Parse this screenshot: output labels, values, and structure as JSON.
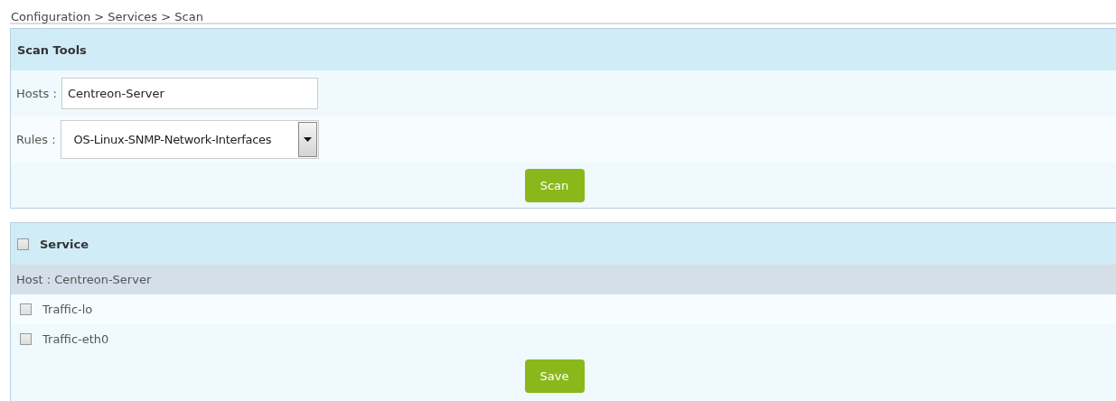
{
  "breadcrumb": "Configuration > Services > Scan",
  "scan_tools": {
    "title": "Scan Tools",
    "hosts": {
      "label": "Hosts :",
      "value": "Centreon-Server"
    },
    "rules": {
      "label": "Rules :",
      "value": "OS-Linux-SNMP-Network-Interfaces"
    },
    "button": "Scan"
  },
  "services": {
    "header": {
      "label": "Service",
      "checked": false
    },
    "host_label": "Host : Centreon-Server",
    "rows": [
      {
        "name": "Traffic-lo",
        "checked": false
      },
      {
        "name": "Traffic-eth0",
        "checked": false
      }
    ],
    "button": "Save"
  }
}
